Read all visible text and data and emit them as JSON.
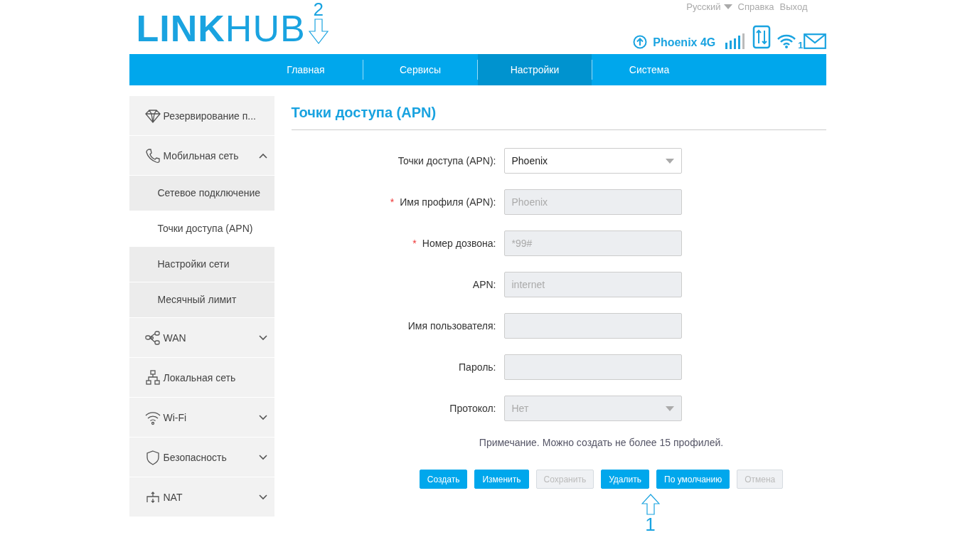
{
  "header": {
    "logo_bold": "LINK",
    "logo_light": "HUB",
    "links": [
      "Русский",
      "Справка",
      "Выход"
    ],
    "network_name": "Phoenix 4G",
    "wifi_clients": "1"
  },
  "nav": [
    {
      "label": "Главная",
      "selected": false
    },
    {
      "label": "Сервисы",
      "selected": false
    },
    {
      "label": "Настройки",
      "selected": true
    },
    {
      "label": "Система",
      "selected": false
    }
  ],
  "sidebar": [
    {
      "label": "Резервирование п...",
      "kind": "link"
    },
    {
      "label": "Мобильная сеть",
      "kind": "group",
      "expanded": true,
      "children": [
        {
          "label": "Сетевое подключение",
          "selected": false
        },
        {
          "label": "Точки доступа (APN)",
          "selected": true
        },
        {
          "label": "Настройки сети",
          "selected": false
        },
        {
          "label": "Месячный лимит",
          "selected": false
        }
      ]
    },
    {
      "label": "WAN",
      "kind": "group",
      "expanded": false
    },
    {
      "label": "Локальная сеть",
      "kind": "link"
    },
    {
      "label": "Wi-Fi",
      "kind": "group",
      "expanded": false
    },
    {
      "label": "Безопасность",
      "kind": "group",
      "expanded": false
    },
    {
      "label": "NAT",
      "kind": "group",
      "expanded": false
    }
  ],
  "page_title": "Точки доступа (APN)",
  "form": [
    {
      "label": "Точки доступа (APN):",
      "kind": "select",
      "value": "Phoenix",
      "disabled": false
    },
    {
      "label": "Имя профиля (APN):",
      "kind": "text",
      "value": "Phoenix",
      "required_mark": "*",
      "disabled": true
    },
    {
      "label": "Номер дозвона:",
      "kind": "text",
      "value": "*99#",
      "required_mark": "*",
      "disabled": true
    },
    {
      "label": "APN:",
      "kind": "text",
      "value": "internet",
      "disabled": true
    },
    {
      "label": "Имя пользователя:",
      "kind": "text",
      "disabled": true
    },
    {
      "label": "Пароль:",
      "kind": "text",
      "disabled": true
    },
    {
      "label": "Протокол:",
      "kind": "select",
      "value": "Нет",
      "disabled": true
    }
  ],
  "note": "Примечание. Можно создать не более 15 профилей.",
  "buttons": [
    {
      "label": "Создать",
      "disabled": false
    },
    {
      "label": "Изменить",
      "disabled": false
    },
    {
      "label": "Сохранить",
      "disabled": true
    },
    {
      "label": "Удалить",
      "disabled": false
    },
    {
      "label": "По умолчанию",
      "disabled": false
    },
    {
      "label": "Отмена",
      "disabled": true
    }
  ],
  "annotations": [
    "2",
    "1"
  ]
}
